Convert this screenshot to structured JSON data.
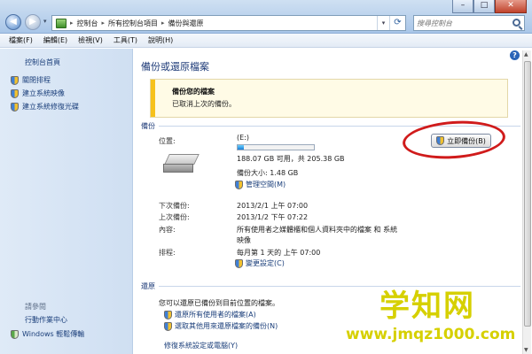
{
  "window": {
    "controls": {
      "minimize": "–",
      "maximize": "□",
      "close": "✕"
    }
  },
  "nav": {
    "back": "◀",
    "forward": "▶",
    "dropdown": "▾"
  },
  "address": {
    "breadcrumbs": [
      "控制台",
      "所有控制台項目",
      "備份與還原"
    ],
    "separator": "▸",
    "dropdown": "▾",
    "refresh": "⟳"
  },
  "search": {
    "placeholder": "搜尋控制台"
  },
  "menu": [
    "檔案(F)",
    "編輯(E)",
    "檢視(V)",
    "工具(T)",
    "說明(H)"
  ],
  "sidebar": {
    "home": "控制台首頁",
    "tasks": [
      "關閉排程",
      "建立系統映像",
      "建立系統修復光碟"
    ],
    "see_also": "請參閱",
    "action_center": "行動作業中心",
    "windows_transfer": "Windows 輕鬆傳輸"
  },
  "main": {
    "help": "?",
    "title": "備份或還原檔案",
    "notice": {
      "title": "備份您的檔案",
      "text": "已取消上次的備份。"
    },
    "backup_section": "備份",
    "location_label": "位置:",
    "location_value": "(E:)",
    "disk_usage_fraction": 0.08,
    "free_space": "188.07 GB 可用，共 205.38 GB",
    "backup_size": "備份大小: 1.48 GB",
    "manage_space": "管理空間(M)",
    "backup_now": "立即備份(B)",
    "next_backup_label": "下次備份:",
    "next_backup_value": "2013/2/1 上午 07:00",
    "last_backup_label": "上次備份:",
    "last_backup_value": "2013/1/2 下午 07:22",
    "contents_label": "內容:",
    "contents_value_line1": "所有使用者之媒體櫃和個人資料夾中的檔案 和 系統",
    "contents_value_line2": "映像",
    "schedule_label": "排程:",
    "schedule_value": "每月第 1 天的 上午 07:00",
    "change_settings": "變更設定(C)",
    "restore_section": "還原",
    "restore_text": "您可以還原已備份到目前位置的檔案。",
    "restore_all_users": "還原所有使用者的檔案(A)",
    "select_other_backup": "選取其他用來還原檔案的備份(N)",
    "recover_settings": "修復系統設定或電腦(Y)"
  },
  "watermark": {
    "title": "学知网",
    "url": "www.jmqz1000.com"
  },
  "colors": {
    "highlight_ring": "#d01b1b",
    "notice_bar": "#f6c11c",
    "link": "#1a3e7a"
  }
}
